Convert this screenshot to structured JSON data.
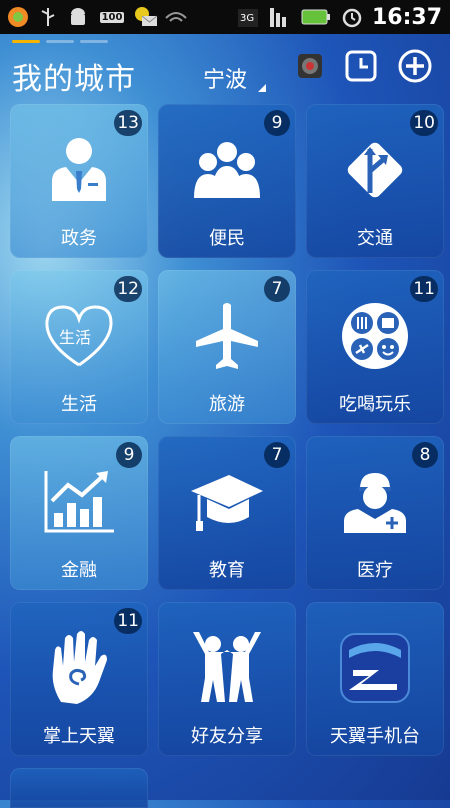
{
  "status_bar": {
    "time": "16:37",
    "battery_text": "100",
    "network_3g": "3G",
    "network_1x": "3G 1X",
    "icons": [
      "app-icon",
      "usb-icon",
      "android-icon",
      "battery-100-icon",
      "mail-icon",
      "wifi-icon",
      "signal-3g-icon",
      "signal-1x-icon",
      "battery-icon",
      "alarm-icon"
    ]
  },
  "header": {
    "title": "我的城市",
    "city": "宁波",
    "buttons": [
      "camera-icon",
      "clock-icon",
      "add-icon"
    ]
  },
  "tiles": [
    {
      "label": "政务",
      "count": "13",
      "icon": "official-icon"
    },
    {
      "label": "便民",
      "count": "9",
      "icon": "people-icon"
    },
    {
      "label": "交通",
      "count": "10",
      "icon": "road-sign-icon"
    },
    {
      "label": "生活",
      "count": "12",
      "icon": "heart-life-icon",
      "icon_text": "生活"
    },
    {
      "label": "旅游",
      "count": "7",
      "icon": "airplane-icon"
    },
    {
      "label": "吃喝玩乐",
      "count": "11",
      "icon": "entertainment-icon"
    },
    {
      "label": "金融",
      "count": "9",
      "icon": "chart-icon"
    },
    {
      "label": "教育",
      "count": "7",
      "icon": "graduation-cap-icon"
    },
    {
      "label": "医疗",
      "count": "8",
      "icon": "doctor-icon"
    },
    {
      "label": "掌上天翼",
      "count": "11",
      "icon": "palm-icon"
    },
    {
      "label": "好友分享",
      "count": "",
      "icon": "friends-icon"
    },
    {
      "label": "天翼手机台",
      "count": "",
      "icon": "tv-logo-icon"
    }
  ]
}
